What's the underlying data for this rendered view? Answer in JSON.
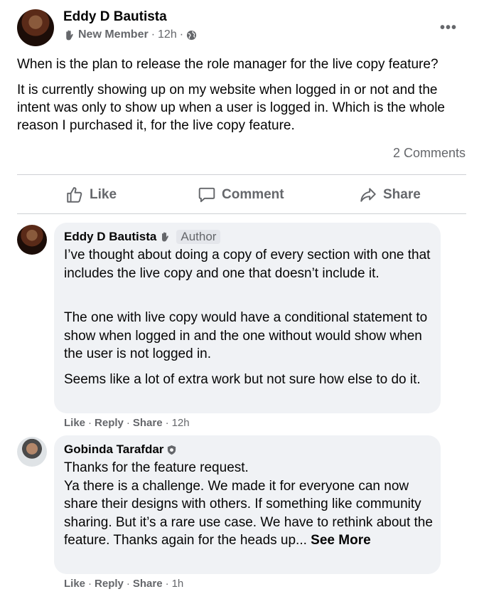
{
  "post": {
    "author": "Eddy D Bautista",
    "member_badge": "New Member",
    "time": "12h",
    "separator": "·",
    "more": "•••",
    "paragraph1": "When is the plan to release the role manager for the live copy feature?",
    "paragraph2": "It is currently showing up on my website when logged in or not and the intent was only to show up when a user is logged in. Which is the whole reason I purchased it, for the live copy feature.",
    "comment_count": "2 Comments"
  },
  "actions": {
    "like": "Like",
    "comment": "Comment",
    "share": "Share"
  },
  "comments": [
    {
      "author": "Eddy D Bautista",
      "tag": "Author",
      "p1": "I’ve thought about doing a copy of every section with one that includes the live copy and one that doesn’t include it.",
      "p2": "The one with live copy would have a conditional statement to show when logged in and the one without would show when the user is not logged in.",
      "p3": "Seems like a lot of extra work but not sure how else to do it.",
      "like": "Like",
      "reply": "Reply",
      "share": "Share",
      "time": "12h"
    },
    {
      "author": "Gobinda Tarafdar",
      "text": "Thanks for the feature request.\nYa there is a challenge. We made it for everyone can now share their designs with others. If something like community sharing. But it’s a rare use case. We have to rethink about the feature. Thanks again for the heads up...",
      "see_more": "See More",
      "like": "Like",
      "reply": "Reply",
      "share": "Share",
      "time": "1h"
    }
  ],
  "colors": {
    "secondary_text": "#65676b",
    "bubble_bg": "#f0f2f5",
    "divider": "#ced0d4"
  }
}
